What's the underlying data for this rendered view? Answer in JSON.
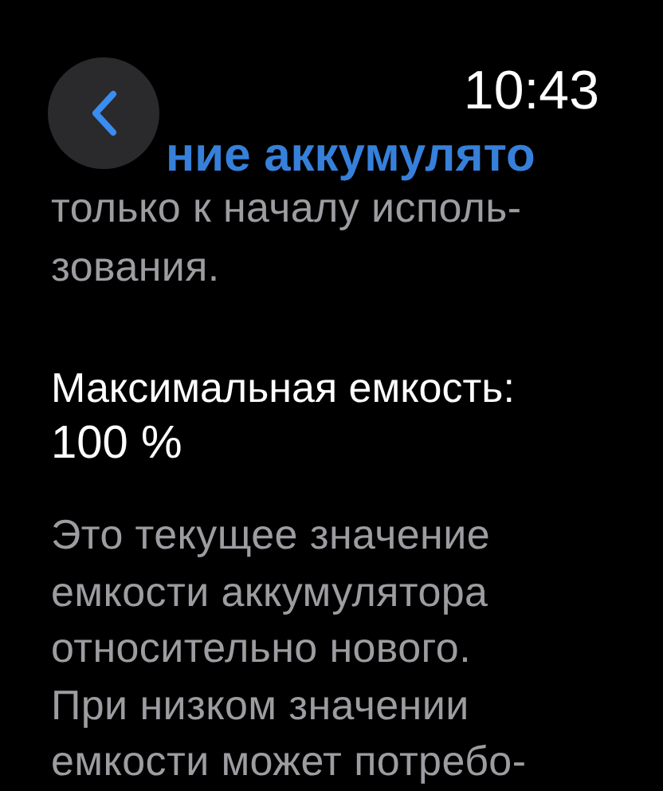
{
  "status_bar": {
    "time": "10:43"
  },
  "title": "ние аккумулято",
  "intro": {
    "lines": [
      "только к началу исполь-",
      "зования."
    ]
  },
  "max_capacity": {
    "label": "Максимальная емкость:",
    "value": "100 %"
  },
  "description": {
    "lines": [
      "Это текущее значение",
      "емкости аккумулятора",
      "относительно нового.",
      "При низком значении",
      "емкости может потребо-"
    ]
  }
}
